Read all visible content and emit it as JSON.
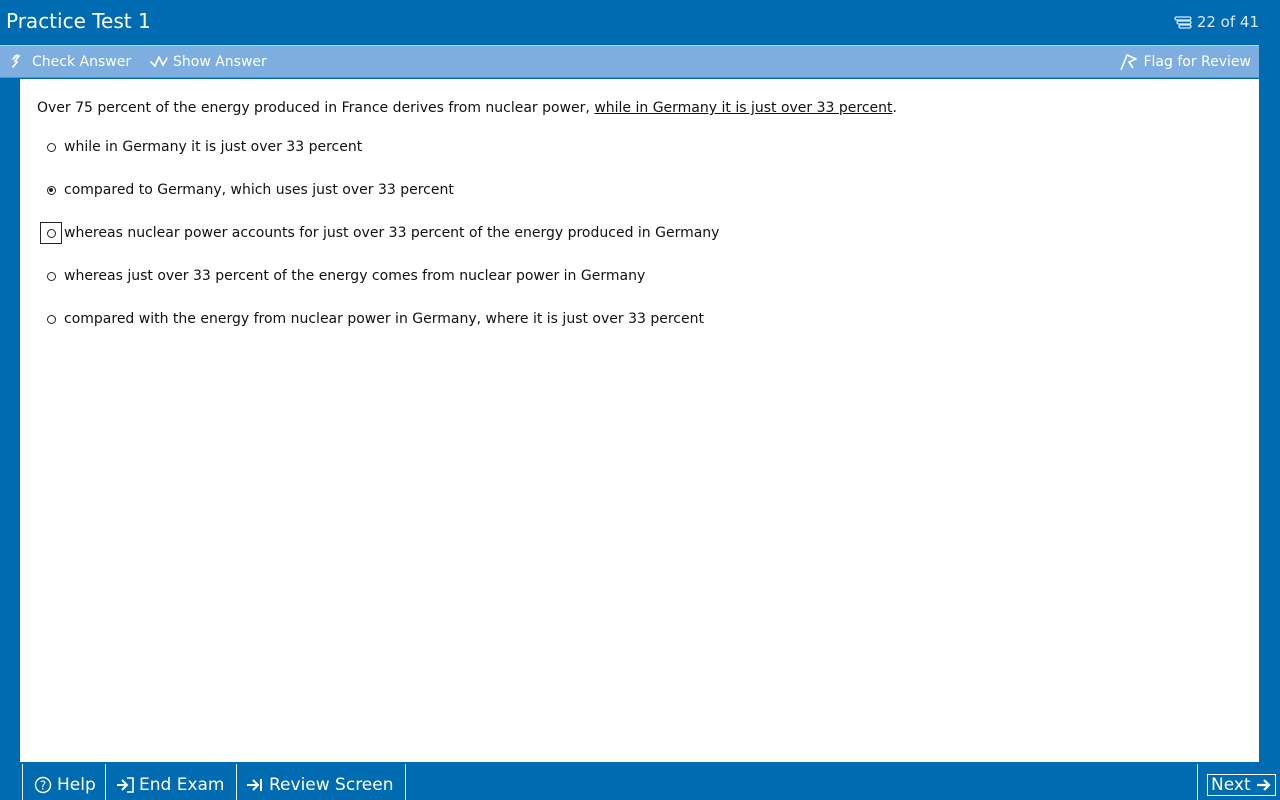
{
  "header": {
    "title": "Practice Test 1",
    "progress": "22 of 41",
    "progress_icon": "question-stack-icon"
  },
  "toolbar": {
    "check_answer": "Check Answer",
    "show_answer": "Show Answer",
    "flag_for_review": "Flag for Review"
  },
  "question": {
    "stem_prefix": "Over 75 percent of the energy produced in France derives from nuclear power, ",
    "stem_underlined": "while in Germany it is just over 33 percent",
    "stem_suffix": ".",
    "choices": [
      {
        "text": "while in Germany it is just over 33 percent",
        "selected": false
      },
      {
        "text": "compared to Germany, which uses just over 33 percent",
        "selected": true
      },
      {
        "text": "whereas nuclear power accounts for just over 33 percent of the energy produced in Germany",
        "selected": false,
        "focused": true
      },
      {
        "text": "whereas just over 33 percent of the energy comes from nuclear power in Germany",
        "selected": false
      },
      {
        "text": "compared with the energy from nuclear power in Germany, where it is just over 33 percent",
        "selected": false
      }
    ]
  },
  "footer": {
    "help": "Help",
    "end_exam": "End Exam",
    "review_screen": "Review Screen",
    "next": "Next"
  },
  "colors": {
    "primary": "#006bb0",
    "toolbar": "#7eaee0",
    "content_bg": "#ffffff"
  }
}
